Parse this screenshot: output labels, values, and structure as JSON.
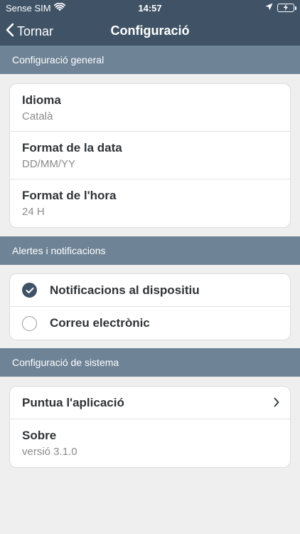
{
  "status": {
    "carrier": "Sense SIM",
    "time": "14:57"
  },
  "nav": {
    "back_label": "Tornar",
    "title": "Configuració"
  },
  "sections": {
    "general": {
      "header": "Configuració general",
      "rows": [
        {
          "title": "Idioma",
          "value": "Català"
        },
        {
          "title": "Format de la data",
          "value": "DD/MM/YY"
        },
        {
          "title": "Format de l'hora",
          "value": "24 H"
        }
      ]
    },
    "alerts": {
      "header": "Alertes i notificacions",
      "options": [
        {
          "label": "Notificacions al dispositiu",
          "checked": true
        },
        {
          "label": "Correu electrònic",
          "checked": false
        }
      ]
    },
    "system": {
      "header": "Configuració de sistema",
      "rate_label": "Puntua l'aplicació",
      "about_title": "Sobre",
      "about_value": "versió 3.1.0"
    }
  },
  "colors": {
    "nav_bg": "#3f5266",
    "section_bg": "#6f8396",
    "page_bg": "#efefef",
    "check_fill": "#3f5266"
  },
  "icons": {
    "wifi": "wifi-icon",
    "location": "location-arrow-icon",
    "battery": "battery-charging-icon",
    "back": "chevron-left-icon",
    "check": "checkmark-icon",
    "forward": "chevron-right-icon"
  }
}
